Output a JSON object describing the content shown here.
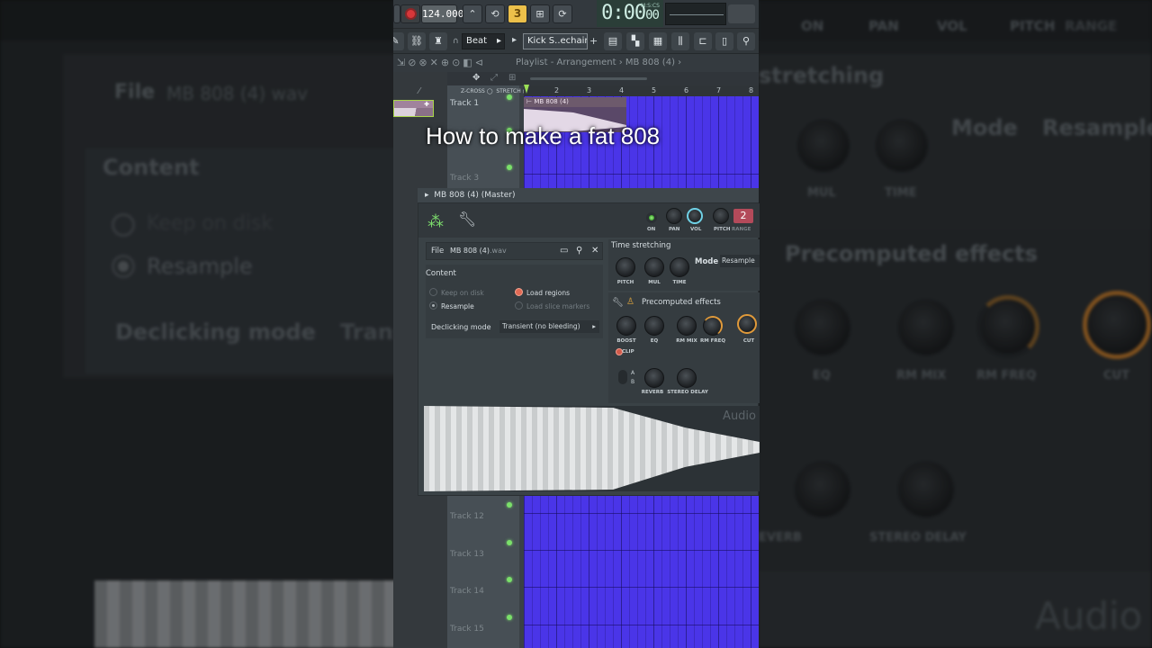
{
  "caption": "How to make a fat 808",
  "toolbar": {
    "tempo": "124.000",
    "pattern_number": "3",
    "time_display": "0:00",
    "time_ms": "00",
    "time_format_label": "M:S:CS",
    "snap_mode": "Beat",
    "instrument_field": "Kick S..echain",
    "breadcrumb": "Playlist - Arrangement › MB 808 (4) ›"
  },
  "playlist": {
    "ruler_numbers": [
      "2",
      "3",
      "4",
      "5",
      "6",
      "7",
      "8"
    ],
    "snap_left": "Z-CROSS",
    "snap_right": "STRETCH",
    "clip_name": "MB 808 (4)",
    "tracks": [
      "Track 1",
      "Track 3",
      "Track 12",
      "Track 13",
      "Track 14",
      "Track 15"
    ],
    "grid_color": "#4a35e8"
  },
  "channel": {
    "title": "MB 808 (4) (Master)",
    "header_knobs": [
      "ON",
      "PAN",
      "VOL",
      "PITCH",
      "RANGE"
    ],
    "range_value": "2",
    "file_label": "File",
    "file_name": "MB 808 (4)",
    "file_ext": ".wav",
    "content_title": "Content",
    "content_options": {
      "keep_on_disk": "Keep on disk",
      "resample": "Resample",
      "load_regions": "Load regions",
      "load_slice_markers": "Load slice markers"
    },
    "declicking_label": "Declicking mode",
    "declicking_value": "Transient (no bleeding)",
    "time_stretching_title": "Time stretching",
    "ts_knobs": [
      "PITCH",
      "MUL",
      "TIME"
    ],
    "mode_label": "Mode",
    "mode_value": "Resample",
    "precomputed_title": "Precomputed effects",
    "pe_knobs_row1": [
      "BOOST",
      "EQ",
      "RM MIX",
      "RM FREQ",
      "CUT"
    ],
    "clip_label": "CLIP",
    "ab_a": "A",
    "ab_b": "B",
    "pe_knobs_row2": [
      "REVERB",
      "STEREO DELAY"
    ],
    "wave_watermark": "Audio",
    "accent_orange": "#e09a3a",
    "accent_green": "#7cdc6c"
  },
  "backdrop": {
    "file_label": "File",
    "file_name": "MB 808 (4) wav",
    "content": "Content",
    "keep_on_disk": "Keep on disk",
    "resample": "Resample",
    "declicking": "Declicking mode",
    "declick_value": "Trans",
    "stretching": "stretching",
    "mode": "Mode",
    "mode_value": "Resample",
    "precomputed": "Precomputed effects",
    "top_labels": [
      "ON",
      "PAN",
      "VOL",
      "PITCH",
      "RANGE"
    ],
    "ts_labels": [
      "MUL",
      "TIME"
    ],
    "pe_labels": [
      "EQ",
      "RM MIX",
      "RM FREQ",
      "CUT"
    ],
    "pe_labels2": [
      "EVERB",
      "STEREO DELAY"
    ],
    "audio": "Audio"
  }
}
